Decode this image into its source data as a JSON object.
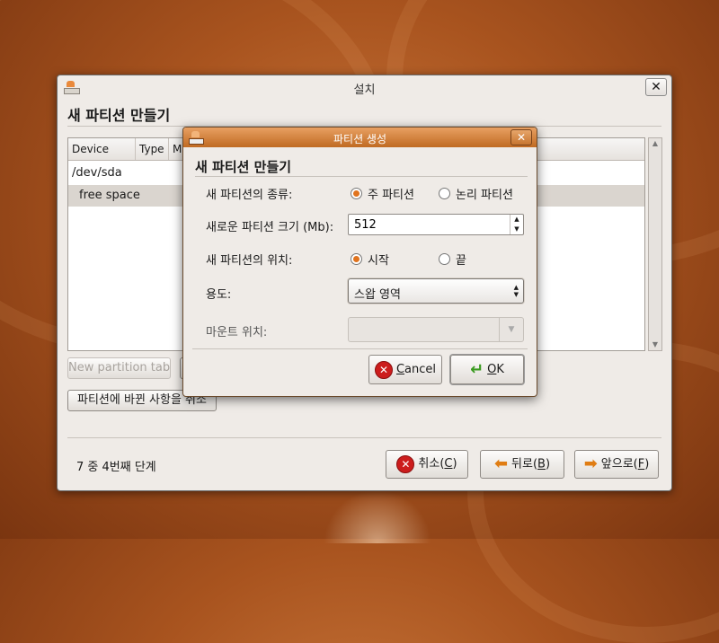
{
  "window": {
    "title": "설치",
    "close_glyph": "✕",
    "heading": "새 파티션 만들기",
    "table": {
      "columns": [
        "Device",
        "Type",
        "M"
      ],
      "rows": [
        {
          "device": "/dev/sda",
          "selected": false
        },
        {
          "device": "free space",
          "selected": true
        }
      ]
    },
    "buttons": {
      "new_partition_table": "New partition table",
      "undo_changes": "파티션에 바뀐 사항을 취소"
    },
    "step_label": "7 중 4번째 단계",
    "nav": {
      "cancel_prefix": "취소(",
      "cancel_key": "C",
      "cancel_suffix": ")",
      "back_prefix": "뒤로(",
      "back_key": "B",
      "back_suffix": ")",
      "forward_prefix": "앞으로(",
      "forward_key": "F",
      "forward_suffix": ")"
    }
  },
  "dialog": {
    "title": "파티션 생성",
    "close_glyph": "✕",
    "heading": "새 파티션 만들기",
    "type_label": "새 파티션의 종류:",
    "type_primary": "주 파티션",
    "type_logical": "논리 파티션",
    "type_selected": "primary",
    "size_label": "새로운 파티션 크기 (Mb):",
    "size_value": "512",
    "location_label": "새 파티션의 위치:",
    "location_start": "시작",
    "location_end": "끝",
    "location_selected": "start",
    "use_label": "용도:",
    "use_value": "스왑 영역",
    "mount_label": "마운트 위치:",
    "mount_value": "",
    "cancel_first": "C",
    "cancel_rest": "ancel",
    "ok_first": "O",
    "ok_rest": "K"
  },
  "colors": {
    "accent": "#e0731e",
    "dialog_titlebar": "#c06a22",
    "window_bg": "#efebe7"
  },
  "icons": [
    "installer-icon",
    "close-icon",
    "cancel-icon",
    "back-arrow-icon",
    "forward-arrow-icon",
    "ok-check-icon"
  ]
}
